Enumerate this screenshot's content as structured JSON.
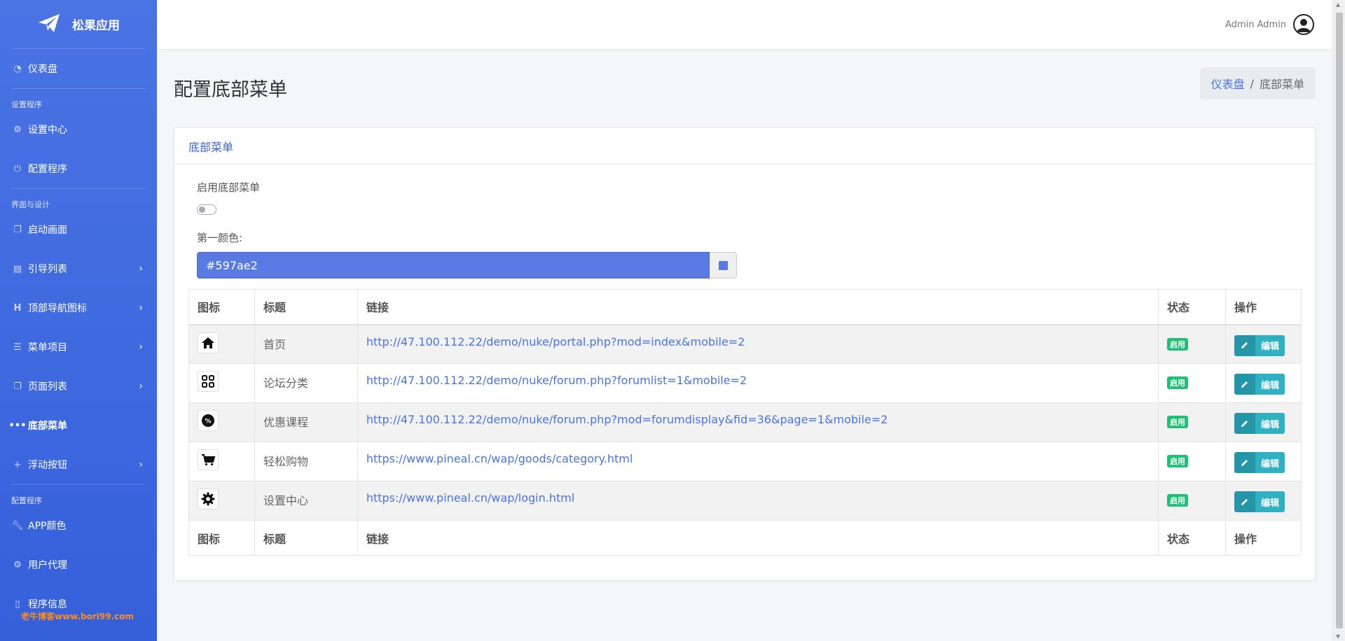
{
  "brand": {
    "title": "松果应用"
  },
  "sidebar": {
    "dashboard": "仪表盘",
    "heading_setup": "设置程序",
    "settings_center": "设置中心",
    "config_program": "配置程序",
    "heading_ui": "界面与设计",
    "splash": "启动画面",
    "guide_list": "引导列表",
    "top_nav_icons": "顶部导航图标",
    "menu_items": "菜单项目",
    "page_list": "页面列表",
    "bottom_menu": "底部菜单",
    "float_button": "浮动按钮",
    "heading_config": "配置程序",
    "app_color": "APP颜色",
    "user_agent": "用户代理",
    "program_info": "程序信息",
    "watermark": "老牛博客www.bori99.com"
  },
  "topbar": {
    "user_name": "Admin Admin"
  },
  "page": {
    "title": "配置底部菜单"
  },
  "breadcrumb": {
    "home": "仪表盘",
    "sep": "/",
    "current": "底部菜单"
  },
  "card": {
    "title": "底部菜单",
    "enable_label": "启用底部菜单",
    "enable_on": false,
    "color_label": "第一颜色:",
    "color_value": "#597ae2"
  },
  "table": {
    "headers": [
      "图标",
      "标题",
      "链接",
      "状态",
      "操作"
    ],
    "rows": [
      {
        "icon": "home-icon",
        "title": "首页",
        "link": "http://47.100.112.22/demo/nuke/portal.php?mod=index&mobile=2",
        "status": "启用",
        "action": "编辑"
      },
      {
        "icon": "grid-icon",
        "title": "论坛分类",
        "link": "http://47.100.112.22/demo/nuke/forum.php?forumlist=1&mobile=2",
        "status": "启用",
        "action": "编辑"
      },
      {
        "icon": "percent-badge-icon",
        "title": "优惠课程",
        "link": "http://47.100.112.22/demo/nuke/forum.php?mod=forumdisplay&fid=36&page=1&mobile=2",
        "status": "启用",
        "action": "编辑"
      },
      {
        "icon": "cart-icon",
        "title": "轻松购物",
        "link": "https://www.pineal.cn/wap/goods/category.html",
        "status": "启用",
        "action": "编辑"
      },
      {
        "icon": "gear-icon",
        "title": "设置中心",
        "link": "https://www.pineal.cn/wap/login.html",
        "status": "启用",
        "action": "编辑"
      }
    ]
  },
  "colors": {
    "sidebar": "#4a74e4",
    "accent": "#4a74e4",
    "badge": "#1fbf75",
    "edit": "#2fb0c3"
  }
}
